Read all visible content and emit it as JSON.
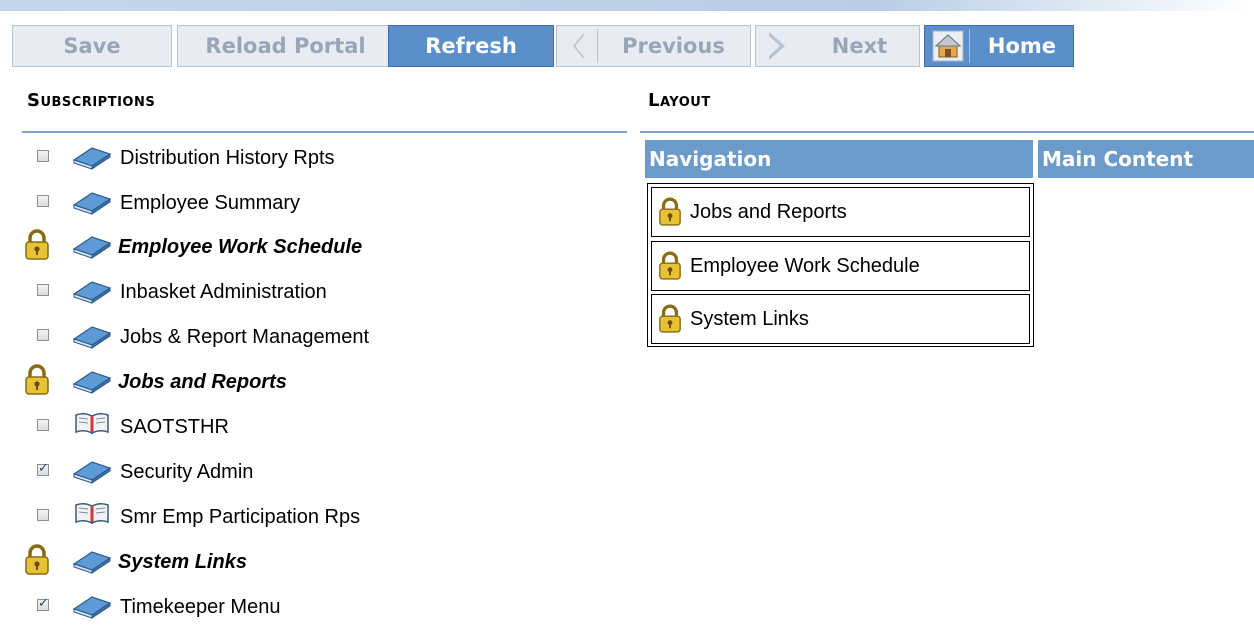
{
  "toolbar": {
    "save": "Save",
    "reload_portal": "Reload Portal",
    "refresh": "Refresh",
    "previous": "Previous",
    "next": "Next",
    "home": "Home"
  },
  "subscriptions": {
    "title": "Subscriptions",
    "items": [
      {
        "label": "Distribution History Rpts",
        "locked": false,
        "checked": false,
        "icon": "book-blue-icon"
      },
      {
        "label": "Employee Summary",
        "locked": false,
        "checked": false,
        "icon": "book-blue-icon"
      },
      {
        "label": "Employee Work Schedule",
        "locked": true,
        "checked": false,
        "icon": "book-blue-icon"
      },
      {
        "label": "Inbasket Administration",
        "locked": false,
        "checked": false,
        "icon": "book-blue-icon"
      },
      {
        "label": "Jobs & Report Management",
        "locked": false,
        "checked": false,
        "icon": "book-blue-icon"
      },
      {
        "label": "Jobs and Reports",
        "locked": true,
        "checked": false,
        "icon": "book-blue-icon"
      },
      {
        "label": "SAOTSTHR",
        "locked": false,
        "checked": false,
        "icon": "book-open-icon"
      },
      {
        "label": "Security Admin",
        "locked": false,
        "checked": true,
        "icon": "book-blue-icon"
      },
      {
        "label": "Smr Emp Participation Rps",
        "locked": false,
        "checked": false,
        "icon": "book-open-icon"
      },
      {
        "label": "System Links",
        "locked": true,
        "checked": false,
        "icon": "book-blue-icon"
      },
      {
        "label": "Timekeeper Menu",
        "locked": false,
        "checked": true,
        "icon": "book-blue-icon"
      }
    ]
  },
  "layout": {
    "title": "Layout",
    "navigation_header": "Navigation",
    "main_content_header": "Main Content",
    "navigation_items": [
      {
        "label": "Jobs and Reports"
      },
      {
        "label": "Employee Work Schedule"
      },
      {
        "label": "System Links"
      }
    ]
  },
  "colors": {
    "accent": "#5b8fc9",
    "header_blue": "#6b9bcb",
    "disabled_text": "#9aa6b8"
  }
}
